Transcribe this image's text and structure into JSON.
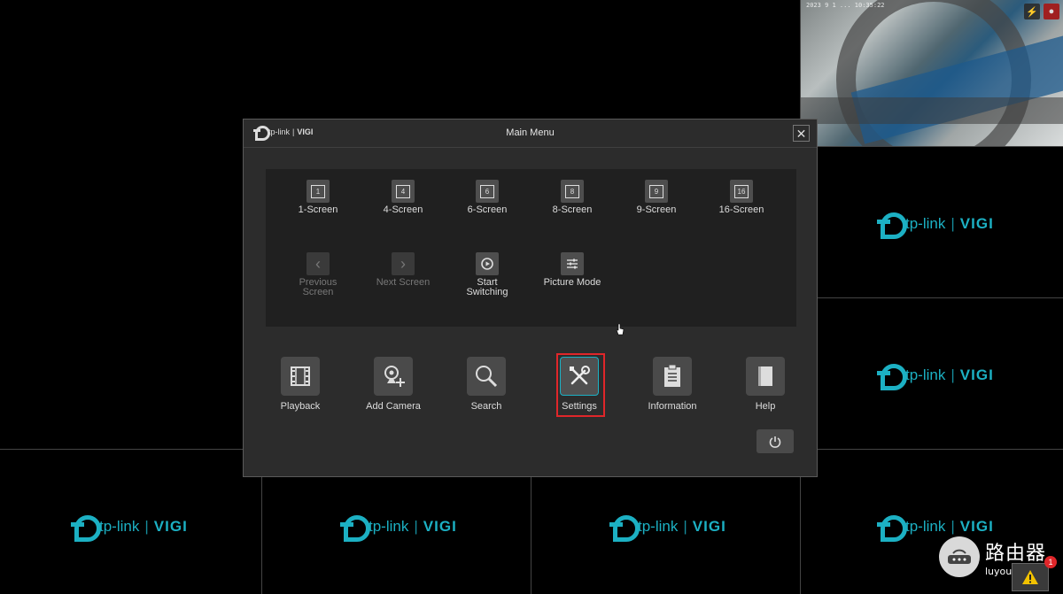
{
  "brand": {
    "name": "tp-link",
    "product": "VIGI",
    "separator": "|",
    "accent": "#1cb0c3"
  },
  "camera_feed": {
    "timestamp": "2023 9 1 ... 10:35:22"
  },
  "dialog": {
    "title": "Main Menu",
    "close_icon": "close-icon",
    "layout_items": [
      {
        "label": "1-Screen",
        "glyph": "1"
      },
      {
        "label": "4-Screen",
        "glyph": "4"
      },
      {
        "label": "6-Screen",
        "glyph": "6"
      },
      {
        "label": "8-Screen",
        "glyph": "8"
      },
      {
        "label": "9-Screen",
        "glyph": "9"
      },
      {
        "label": "16-Screen",
        "glyph": "16"
      }
    ],
    "control_items": [
      {
        "label": "Previous Screen",
        "enabled": false,
        "icon": "chevron-left-icon"
      },
      {
        "label": "Next Screen",
        "enabled": false,
        "icon": "chevron-right-icon"
      },
      {
        "label": "Start Switching",
        "enabled": true,
        "icon": "switch-cycle-icon"
      },
      {
        "label": "Picture Mode",
        "enabled": true,
        "icon": "sliders-icon"
      }
    ],
    "main_items": [
      {
        "label": "Playback",
        "icon": "film-icon"
      },
      {
        "label": "Add Camera",
        "icon": "add-camera-icon"
      },
      {
        "label": "Search",
        "icon": "search-icon"
      },
      {
        "label": "Settings",
        "icon": "wrench-screwdriver-icon",
        "selected": true
      },
      {
        "label": "Information",
        "icon": "clipboard-icon"
      },
      {
        "label": "Help",
        "icon": "book-icon"
      }
    ],
    "power_icon": "power-icon",
    "highlight_color": "#e0262a"
  },
  "watermark": {
    "line1": "路由器",
    "line2": "luyouqi.com"
  },
  "alert": {
    "count": "1",
    "icon": "warning-icon"
  }
}
